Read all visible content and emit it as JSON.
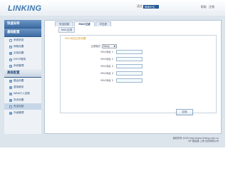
{
  "brand": {
    "logo_text": "LINKING"
  },
  "topbar": {
    "language_label": "语言",
    "language_value": "简体中文",
    "links": [
      "帮助",
      "注销"
    ]
  },
  "sidebar": {
    "quick_wizard": "快速向导",
    "basic_config": "基础配置",
    "basic_items": [
      {
        "label": "系统状态",
        "icon": "status-icon"
      },
      {
        "label": "网络设置",
        "icon": "network-icon"
      },
      {
        "label": "无线设置",
        "icon": "wireless-icon"
      },
      {
        "label": "DHCP服务",
        "icon": "dhcp-icon"
      },
      {
        "label": "系统管理",
        "icon": "system-icon"
      }
    ],
    "advanced_config": "高级配置",
    "advanced_items": [
      {
        "label": "路由设置",
        "icon": "route-icon"
      },
      {
        "label": "虚拟服务",
        "icon": "virtual-icon"
      },
      {
        "label": "WAN介入控制",
        "icon": "wan-icon"
      },
      {
        "label": "安全设置",
        "icon": "security-icon"
      },
      {
        "label": "安全控制",
        "icon": "lock-icon"
      },
      {
        "label": "升级管理",
        "icon": "upgrade-icon"
      }
    ]
  },
  "main": {
    "tabs": [
      "安全控制",
      "MAC过滤",
      "IP过滤"
    ],
    "active_tab": 1,
    "subtab": "MAC过滤",
    "fieldset_title": "MAC地址过滤设置",
    "mode_label": "过滤模式",
    "mode_value": "Deny",
    "mac_rows": [
      {
        "label": "MAC地址 1",
        "value": ""
      },
      {
        "label": "MAC地址 2",
        "value": ""
      },
      {
        "label": "MAC地址 3",
        "value": ""
      },
      {
        "label": "MAC地址 4",
        "value": ""
      },
      {
        "label": "MAC地址 5",
        "value": ""
      }
    ],
    "apply_label": "应用"
  },
  "footer": {
    "line1": "版权所有 2009 http://www.linking.com.cn",
    "line2": "ISP 路由器 上海 无线有限公司"
  },
  "colors": {
    "accent": "#3e6da3",
    "title_orange": "#d8941e",
    "input_bg": "#f4fbfd"
  }
}
